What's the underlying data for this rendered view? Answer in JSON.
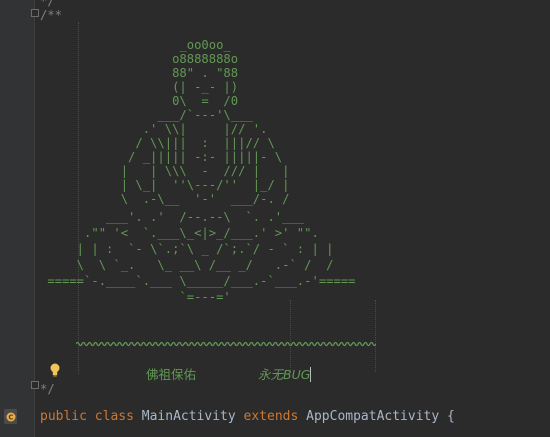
{
  "top_stub": "*/",
  "comment_open": "/**",
  "ascii_art": [
    "                   _oo0oo_",
    "                  o8888888o",
    "                  88\" . \"88",
    "                  (| -_- |)",
    "                  0\\  =  /0",
    "                ___/`---'\\___",
    "              .' \\\\|     |// '.",
    "             / \\\\|||  :  |||// \\",
    "            / _||||| -:- |||||- \\",
    "           |   | \\\\\\  -  /// |   |",
    "           | \\_|  ''\\---/''  |_/ |",
    "           \\  .-\\__  '-'  ___/-. /",
    "         ___'. .'  /--.--\\  `. .'___",
    "      .\"\" '<  `.___\\_<|>_/___.' >' \"\".",
    "     | | :  `- \\`.;`\\ _ /`;.`/ - ` : | |",
    "     \\  \\ `_.   \\_ __\\ /__ _/   .-` /  /",
    " =====`-.____`.___ \\_____/___.-`___.-'=====",
    "                   `=---='"
  ],
  "tilde_line": "~~~~~~~~~~~~~~~~~~~~~~~~~~~~~~~~~~~~~~~~~~~~~~~",
  "blessing_left": "佛祖保佑",
  "blessing_right": "永无BUG",
  "comment_close": "*/",
  "class_decl": {
    "kw_public": "public",
    "kw_class": "class",
    "name": "MainActivity",
    "kw_extends": "extends",
    "parent": "AppCompatActivity",
    "brace": "{"
  },
  "colors": {
    "background": "#2b2b2b",
    "comment": "#808080",
    "doc_text": "#629755",
    "keyword": "#cc7832",
    "plain": "#a9b7c6"
  },
  "icons": [
    "lightbulb-icon",
    "class-file-icon",
    "fold-marker-icon"
  ]
}
